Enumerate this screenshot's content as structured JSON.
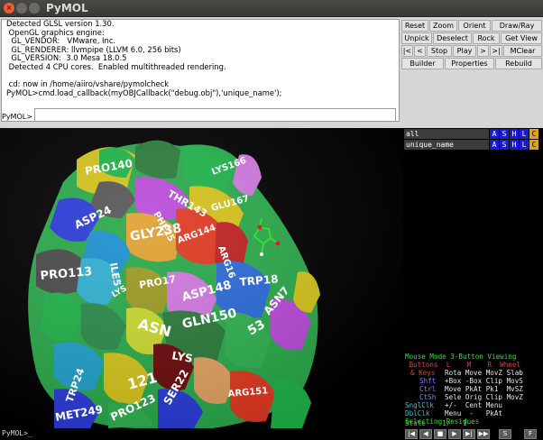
{
  "window": {
    "title": "PyMOL"
  },
  "log_lines": [
    "Detected GLSL version 1.30.",
    " OpenGL graphics engine:",
    "  GL_VENDOR:   VMware, Inc.",
    "  GL_RENDERER: llvmpipe (LLVM 6.0, 256 bits)",
    "  GL_VERSION:  3.0 Mesa 18.0.5",
    " Detected 4 CPU cores.  Enabled multithreaded rendering.",
    "",
    " cd: now in /home/aiiro/vshare/pymolcheck",
    "PyMOL>cmd.load_callback(myOBJCallback(\"debug.obj\"),'unique_name');"
  ],
  "command": {
    "label": "PyMOL>",
    "value": ""
  },
  "buttons": {
    "reset": "Reset",
    "zoom": "Zoom",
    "orient": "Orient",
    "draw_ray": "Draw/Ray",
    "unpick": "Unpick",
    "deselect": "Deselect",
    "rock": "Rock",
    "get_view": "Get View",
    "first": "|<",
    "prev": "<",
    "stop": "Stop",
    "play": "Play",
    "next": ">",
    "last": ">|",
    "mclear": "MClear",
    "builder": "Builder",
    "properties": "Properties",
    "rebuild": "Rebuild"
  },
  "objects": [
    {
      "name": "all",
      "a": "A",
      "s": "S",
      "h": "H",
      "l": "L",
      "c": "C"
    },
    {
      "name": "unique_name",
      "a": "A",
      "s": "S",
      "h": "H",
      "l": "L",
      "c": "C"
    }
  ],
  "residue_labels": [
    "PRO140",
    "LYS166",
    "THR143",
    "GLU167",
    "ASP24",
    "PHE25",
    "GLY238",
    "ARG144",
    "ARG16",
    "PRO113",
    "ILE5",
    "PRO17",
    "ASP148",
    "TRP18",
    "LYS",
    "ASN",
    "GLN150",
    "ASN7",
    "53",
    "LYS",
    "121",
    "SER22",
    "ARG151",
    "TRP24",
    "MET249",
    "PRO123"
  ],
  "mouse_panel": {
    "title": "Mouse Mode 3-Button Viewing",
    "header": " Buttons  L    M    R  Wheel",
    "keys_label": "& Keys",
    "keys_row": "Rota Move MovZ Slab",
    "shft_label": "Shft",
    "shft_row": "+Box -Box Clip MovS",
    "ctrl_label": "Ctrl",
    "ctrl_row": "Move PkAt Pk1  MvSZ",
    "ctsh_label": "CtSh",
    "ctsh_row": "Sele Orig Clip MovZ",
    "snglclk_label": "SnglClk",
    "snglclk_row": "+/-  Cent Menu",
    "dblclk_label": "DblClk",
    "dblclk_row": "Menu  -   PkAt",
    "selecting": "Selecting Residues",
    "state": "State    1/   1"
  },
  "bottom": {
    "prompt": "PyMOL>_",
    "vcr": [
      "|◀",
      "◀",
      "■",
      "▶",
      "▶|",
      "▶▶",
      "S",
      "F"
    ]
  },
  "colors": {
    "titlebar": "#3c3b37",
    "panel_bg": "#d6d6d6",
    "viewer_bg": "#000000",
    "object_btn": "#1b1bd6",
    "object_color_btn": "#e0a020"
  }
}
